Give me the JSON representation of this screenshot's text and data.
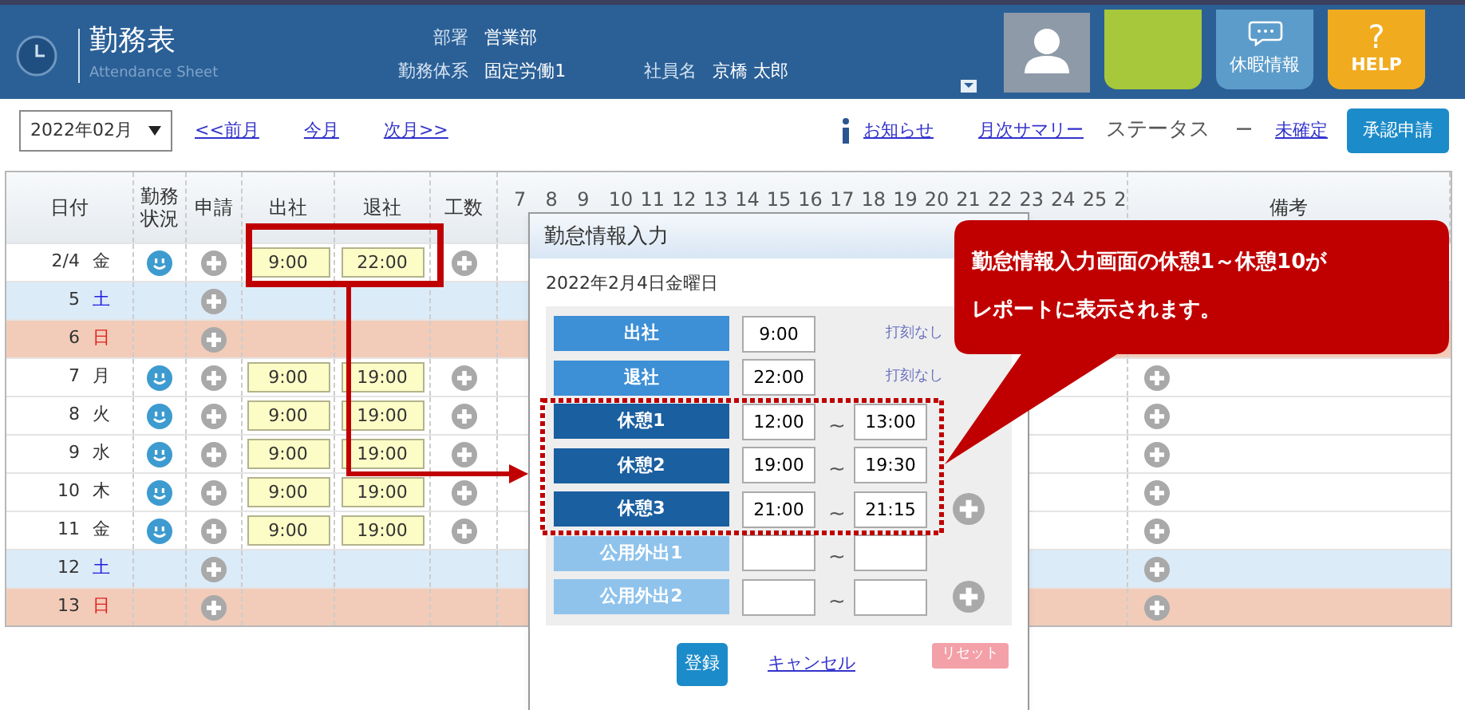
{
  "header": {
    "title": "勤務表",
    "subtitle": "Attendance Sheet",
    "field_rows": [
      [
        {
          "label": "部署",
          "value": "営業部"
        }
      ],
      [
        {
          "label": "勤務体系",
          "value": "固定労働1"
        },
        {
          "label": "社員名",
          "value": "京橋 太郎"
        }
      ]
    ],
    "tiles": [
      {
        "kind": "avatar"
      },
      {
        "kind": "blank"
      },
      {
        "kind": "leave",
        "label": "休暇情報"
      },
      {
        "kind": "help",
        "symbol": "?",
        "label": "HELP"
      }
    ]
  },
  "toolbar": {
    "month": "2022年02月",
    "nav_links": [
      "<<前月",
      "今月",
      "次月>>"
    ],
    "notice_link": "お知らせ",
    "summary_link": "月次サマリー",
    "status_label": "ステータス",
    "status_dash": "ー",
    "status_value": "未確定",
    "submit_button": "承認申請"
  },
  "table": {
    "columns": [
      "日付",
      "勤務状況",
      "申請",
      "出社",
      "退社",
      "工数",
      "備考"
    ],
    "hours": [
      "7",
      "8",
      "9",
      "10",
      "11",
      "12",
      "13",
      "14",
      "15",
      "16",
      "17",
      "18",
      "19",
      "20",
      "21",
      "22",
      "23",
      "24",
      "25",
      "2"
    ],
    "rows": [
      {
        "date": "2/4",
        "weekday": "金",
        "kind": "weekday",
        "status_icon": true,
        "clock_in": "9:00",
        "clock_out": "22:00",
        "hours_add": true,
        "note_add": false
      },
      {
        "date": "5",
        "weekday": "土",
        "kind": "saturday",
        "status_icon": false,
        "hours_add": false,
        "note_add": false
      },
      {
        "date": "6",
        "weekday": "日",
        "kind": "sunday",
        "status_icon": false,
        "hours_add": false,
        "note_add": false
      },
      {
        "date": "7",
        "weekday": "月",
        "kind": "weekday",
        "status_icon": true,
        "clock_in": "9:00",
        "clock_out": "19:00",
        "hours_add": true,
        "note_add": true
      },
      {
        "date": "8",
        "weekday": "火",
        "kind": "weekday",
        "status_icon": true,
        "clock_in": "9:00",
        "clock_out": "19:00",
        "hours_add": true,
        "note_add": true
      },
      {
        "date": "9",
        "weekday": "水",
        "kind": "weekday",
        "status_icon": true,
        "clock_in": "9:00",
        "clock_out": "19:00",
        "hours_add": true,
        "note_add": true
      },
      {
        "date": "10",
        "weekday": "木",
        "kind": "weekday",
        "status_icon": true,
        "clock_in": "9:00",
        "clock_out": "19:00",
        "hours_add": true,
        "note_add": true
      },
      {
        "date": "11",
        "weekday": "金",
        "kind": "weekday",
        "status_icon": true,
        "clock_in": "9:00",
        "clock_out": "19:00",
        "hours_add": true,
        "note_add": true
      },
      {
        "date": "12",
        "weekday": "土",
        "kind": "saturday",
        "status_icon": false,
        "hours_add": false,
        "note_add": true
      },
      {
        "date": "13",
        "weekday": "日",
        "kind": "sunday",
        "status_icon": false,
        "hours_add": false,
        "note_add": true
      }
    ]
  },
  "dialog": {
    "title": "勤怠情報入力",
    "date": "2022年2月4日金曜日",
    "rows": [
      {
        "kind": "clock",
        "label": "出社",
        "value": "9:00",
        "note": "打刻なし",
        "add": false
      },
      {
        "kind": "clock",
        "label": "退社",
        "value": "22:00",
        "note": "打刻なし",
        "add": false
      },
      {
        "kind": "break",
        "label": "休憩1",
        "start": "12:00",
        "separator": "~",
        "end": "13:00",
        "add": false
      },
      {
        "kind": "break",
        "label": "休憩2",
        "start": "19:00",
        "separator": "~",
        "end": "19:30",
        "add": false
      },
      {
        "kind": "break",
        "label": "休憩3",
        "start": "21:00",
        "separator": "~",
        "end": "21:15",
        "add": true
      },
      {
        "kind": "outing",
        "label": "公用外出1",
        "separator": "~",
        "add": false
      },
      {
        "kind": "outing",
        "label": "公用外出2",
        "separator": "~",
        "add": true
      }
    ],
    "register_button": "登録",
    "cancel_link": "キャンセル",
    "reset_button": "リセット"
  },
  "callout": {
    "lines": [
      "勤怠情報入力画面の休憩1～休憩10が",
      "レポートに表示されます。"
    ]
  }
}
